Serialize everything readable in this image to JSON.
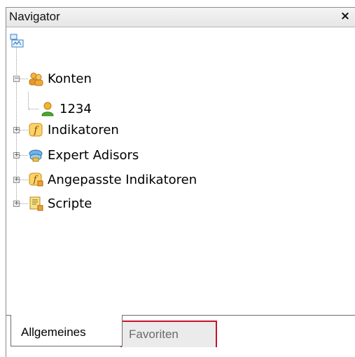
{
  "window": {
    "title": "Navigator",
    "close_glyph": "×"
  },
  "tree": {
    "root_icon": "network-computer-icon",
    "items": [
      {
        "label": "Konten",
        "icon": "accounts-icon",
        "expanded": true
      },
      {
        "label": "1234",
        "icon": "user-account-icon"
      },
      {
        "label": "Indikatoren",
        "icon": "function-icon",
        "expanded": false
      },
      {
        "label": "Expert Adisors",
        "icon": "expert-advisor-icon",
        "expanded": false
      },
      {
        "label": "Angepasste Indikatoren",
        "icon": "custom-function-icon",
        "expanded": false
      },
      {
        "label": "Scripte",
        "icon": "script-icon",
        "expanded": false
      }
    ],
    "expand_glyph": "+",
    "collapse_glyph": "−"
  },
  "tabs": [
    {
      "label": "Allgemeines",
      "active": true
    },
    {
      "label": "Favoriten",
      "active": false,
      "highlight": "#c8102e"
    }
  ]
}
